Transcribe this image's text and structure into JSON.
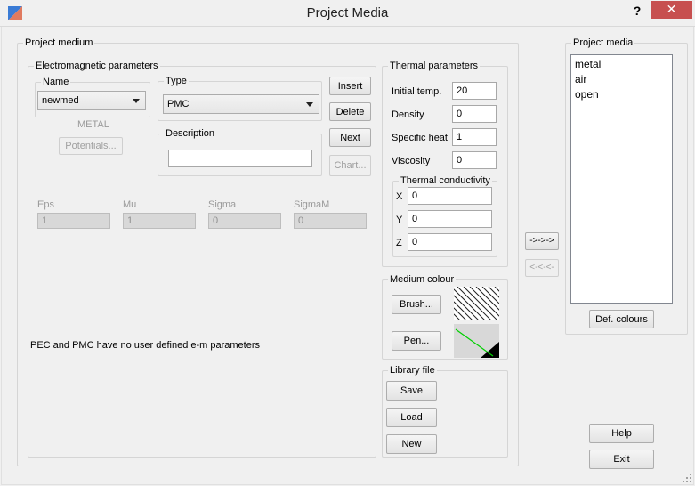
{
  "window": {
    "title": "Project Media",
    "help": "?",
    "close": "✕"
  },
  "project_medium": {
    "title": "Project medium",
    "em": {
      "title": "Electromagnetic parameters",
      "name_group": "Name",
      "name_value": "newmed",
      "type_label": "METAL",
      "potentials_button": "Potentials...",
      "type_group": "Type",
      "type_value": "PMC",
      "description_group": "Description",
      "description_value": "",
      "buttons": {
        "insert": "Insert",
        "delete": "Delete",
        "next": "Next",
        "chart": "Chart..."
      },
      "params": [
        {
          "label": "Eps",
          "value": "1"
        },
        {
          "label": "Mu",
          "value": "1"
        },
        {
          "label": "Sigma",
          "value": "0"
        },
        {
          "label": "SigmaM",
          "value": "0"
        }
      ],
      "note": "PEC and PMC have no user defined e-m parameters"
    },
    "thermal": {
      "title": "Thermal parameters",
      "initial_temp_label": "Initial temp.",
      "initial_temp_value": "20",
      "density_label": "Density",
      "density_value": "0",
      "specific_heat_label": "Specific heat",
      "specific_heat_value": "1",
      "viscosity_label": "Viscosity",
      "viscosity_value": "0",
      "conductivity": {
        "title": "Thermal conductivity",
        "x_label": "X",
        "x_value": "0",
        "y_label": "Y",
        "y_value": "0",
        "z_label": "Z",
        "z_value": "0"
      }
    },
    "colour": {
      "title": "Medium colour",
      "brush_button": "Brush...",
      "pen_button": "Pen..."
    },
    "library": {
      "title": "Library file",
      "save_button": "Save",
      "load_button": "Load",
      "new_button": "New"
    }
  },
  "transfer": {
    "add_button": "->->->",
    "remove_button": "<-<-<-"
  },
  "project_media": {
    "title": "Project media",
    "items": [
      "metal",
      "air",
      "open"
    ],
    "def_colours_button": "Def. colours"
  },
  "footer": {
    "help_button": "Help",
    "exit_button": "Exit"
  },
  "colors": {
    "close_button": "#c75050",
    "accent_icon": "#3a7bd5"
  }
}
